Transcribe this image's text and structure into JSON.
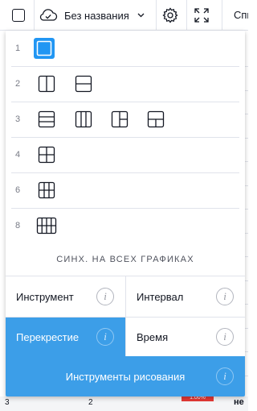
{
  "toolbar": {
    "layout_icon": "layout-square-icon",
    "cloud_icon": "cloud-check-icon",
    "chart_name": "Без названия",
    "chevron_icon": "chevron-down-icon",
    "settings_icon": "gear-icon",
    "fullscreen_icon": "fullscreen-icon",
    "right_tab_label": "Спи"
  },
  "background": {
    "right_letters": [
      "с",
      "р",
      "т",
      "т",
      "с",
      "к",
      "р",
      "с",
      "1",
      "с",
      "р",
      "р",
      "с",
      "с",
      "с"
    ],
    "bottom_numbers": [
      "3",
      "2"
    ],
    "bottom_red_badge": "1.00%",
    "bottom_right_text": "не"
  },
  "layouts": {
    "rows": [
      {
        "number": "1",
        "icons": [
          "layout-1-single-icon"
        ],
        "active_index": 0
      },
      {
        "number": "2",
        "icons": [
          "layout-2-vertical-split-icon",
          "layout-2-horizontal-split-icon"
        ],
        "active_index": -1
      },
      {
        "number": "3",
        "icons": [
          "layout-3-horizontal-rows-icon",
          "layout-3-vertical-columns-icon",
          "layout-3-left-big-icon",
          "layout-3-top-big-icon"
        ],
        "active_index": -1
      },
      {
        "number": "4",
        "icons": [
          "layout-4-grid-icon"
        ],
        "active_index": -1
      },
      {
        "number": "6",
        "icons": [
          "layout-6-grid-icon"
        ],
        "active_index": -1
      },
      {
        "number": "8",
        "icons": [
          "layout-8-grid-icon"
        ],
        "active_index": -1
      }
    ],
    "sync_label": "СИНХ. НА ВСЕХ ГРАФИКАХ"
  },
  "sync_options": [
    {
      "label": "Инструмент",
      "active": false,
      "info_icon": "info-icon"
    },
    {
      "label": "Интервал",
      "active": false,
      "info_icon": "info-icon"
    },
    {
      "label": "Перекрестие",
      "active": true,
      "info_icon": "info-icon"
    },
    {
      "label": "Время",
      "active": false,
      "info_icon": "info-icon"
    }
  ],
  "drawing_tools": {
    "label": "Инструменты рисования",
    "active": true,
    "info_icon": "info-icon"
  },
  "colors": {
    "accent": "#2196f3",
    "active_cell": "#3c9ee8",
    "divider": "#e0e3eb",
    "muted_text": "#787b86"
  }
}
